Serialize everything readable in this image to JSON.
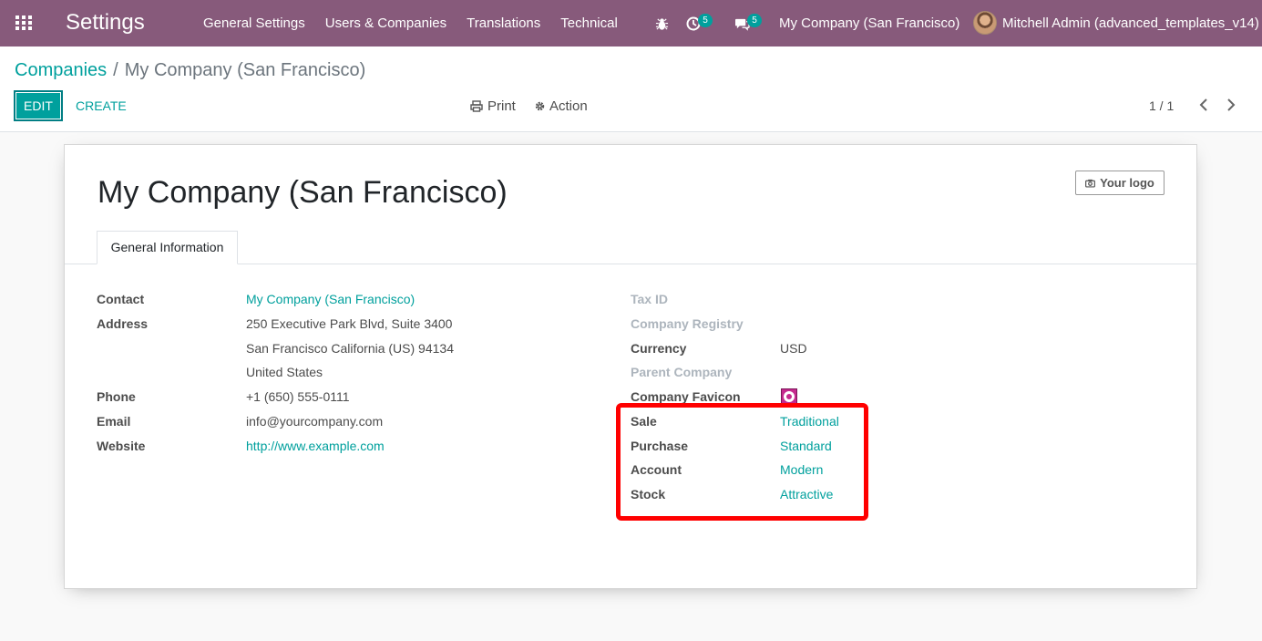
{
  "navbar": {
    "brand": "Settings",
    "menu": [
      "General Settings",
      "Users & Companies",
      "Translations",
      "Technical"
    ],
    "activity_count": "5",
    "messages_count": "5",
    "company_switcher": "My Company (San Francisco)",
    "user_name": "Mitchell Admin (advanced_templates_v14)",
    "accent_color": "#875a7b"
  },
  "control_panel": {
    "breadcrumb_parent": "Companies",
    "breadcrumb_separator": "/",
    "breadcrumb_current": "My Company (San Francisco)",
    "edit_label": "EDIT",
    "create_label": "CREATE",
    "print_label": "Print",
    "action_label": "Action",
    "pager": "1 / 1"
  },
  "form": {
    "title": "My Company (San Francisco)",
    "logo_label": "Your logo",
    "tab_label": "General Information",
    "left_fields": {
      "contact_label": "Contact",
      "contact_value": "My Company (San Francisco)",
      "address_label": "Address",
      "address_line1": "250 Executive Park Blvd, Suite 3400",
      "address_line2": "San Francisco  California (US)  94134",
      "address_line3": "United States",
      "phone_label": "Phone",
      "phone_value": "+1 (650) 555-0111",
      "email_label": "Email",
      "email_value": "info@yourcompany.com",
      "website_label": "Website",
      "website_value": "http://www.example.com"
    },
    "right_fields": {
      "tax_id_label": "Tax ID",
      "registry_label": "Company Registry",
      "currency_label": "Currency",
      "currency_value": "USD",
      "parent_label": "Parent Company",
      "favicon_label": "Company Favicon",
      "sale_label": "Sale",
      "sale_value": "Traditional",
      "purchase_label": "Purchase",
      "purchase_value": "Standard",
      "account_label": "Account",
      "account_value": "Modern",
      "stock_label": "Stock",
      "stock_value": "Attractive"
    },
    "link_color": "#00a09d",
    "highlight_color": "#ff0000"
  }
}
